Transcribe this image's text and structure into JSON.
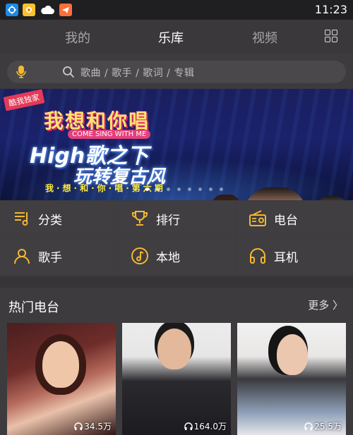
{
  "status_bar": {
    "time": "11:23",
    "icons": [
      "app-blue-icon",
      "app-yellow-icon",
      "cloud-icon",
      "telegram-icon"
    ]
  },
  "header": {
    "tabs": [
      {
        "label": "我的",
        "active": false
      },
      {
        "label": "乐库",
        "active": true
      },
      {
        "label": "视频",
        "active": false
      }
    ],
    "grid_icon": "grid-icon"
  },
  "search": {
    "placeholder": "歌曲 / 歌手 / 歌词 / 专辑",
    "mic_icon": "mic-icon",
    "search_icon": "search-icon"
  },
  "banner": {
    "corner_tag": "酷我独家",
    "title": "我想和你唱",
    "subtitle_en": "COME SING WITH ME",
    "slogan_line1": "High歌之下",
    "slogan_line2": "玩转复古风",
    "tagline": "我·想·和·你·唱·第六期",
    "dot_count": 8,
    "active_dot": 0
  },
  "categories": [
    {
      "label": "分类",
      "icon": "playlist-icon"
    },
    {
      "label": "排行",
      "icon": "trophy-icon"
    },
    {
      "label": "电台",
      "icon": "radio-icon"
    },
    {
      "label": "歌手",
      "icon": "singer-icon"
    },
    {
      "label": "本地",
      "icon": "music-note-icon"
    },
    {
      "label": "耳机",
      "icon": "headphone-icon"
    }
  ],
  "hot_radio": {
    "title": "热门电台",
    "more_label": "更多 〉",
    "items": [
      {
        "listen_count": "34.5万"
      },
      {
        "listen_count": "164.0万"
      },
      {
        "listen_count": "25.5万"
      }
    ]
  },
  "colors": {
    "accent": "#f5b82e",
    "background": "#3d3b3e",
    "status_bar": "#1f1e20"
  }
}
